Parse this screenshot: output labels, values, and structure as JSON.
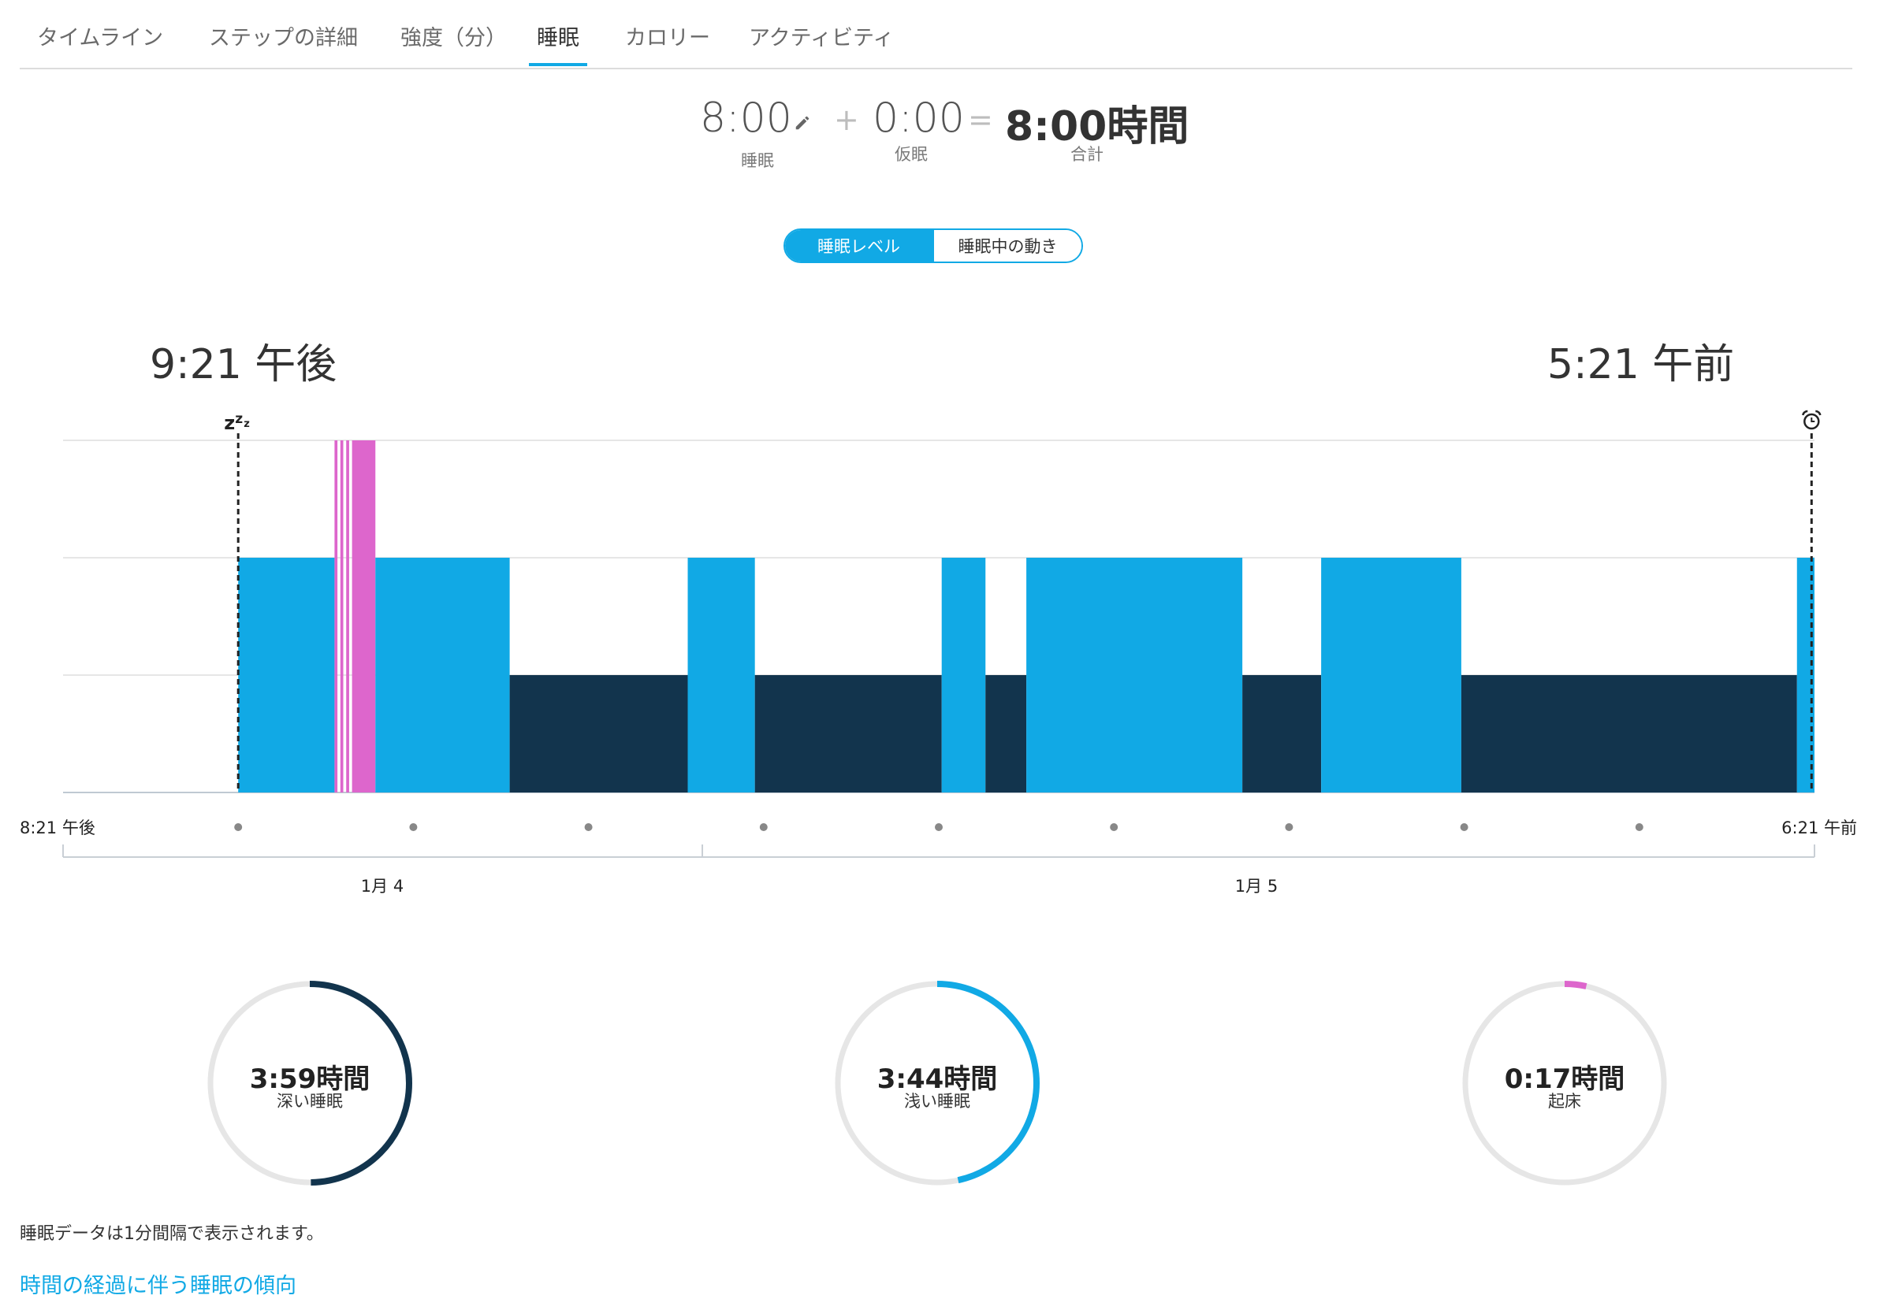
{
  "tabs": [
    {
      "label": "タイムライン"
    },
    {
      "label": "ステップの詳細"
    },
    {
      "label": "強度（分）"
    },
    {
      "label": "睡眠"
    },
    {
      "label": "カロリー"
    },
    {
      "label": "アクティビティ"
    }
  ],
  "active_tab": "睡眠",
  "totals": {
    "sleep_value": "8:00",
    "sleep_label": "睡眠",
    "plus": "+",
    "nap_value": "0:00",
    "nap_label": "仮眠",
    "equals": "=",
    "total_value": "8:00時間",
    "total_label": "合計"
  },
  "toggle": {
    "levels": "睡眠レベル",
    "movement": "睡眠中の動き"
  },
  "sleep_start_time": "9:21 午後",
  "wake_time": "5:21 午前",
  "colors": {
    "deep": "#12344d",
    "light": "#11a9e5",
    "awake": "#dd66cc",
    "grid": "#e6e6e6",
    "track": "#e6e6e6"
  },
  "chart_data": {
    "type": "bar",
    "x_start": "8:21 午後",
    "x_end": "6:21 午前",
    "date_labels": [
      "1月 4",
      "1月 5"
    ],
    "levels": [
      "deep",
      "light",
      "awake"
    ],
    "segments": [
      {
        "level": "light",
        "start": "21:21",
        "end": "21:54"
      },
      {
        "level": "awake",
        "start": "21:54",
        "end": "21:55"
      },
      {
        "level": "awake",
        "start": "21:56",
        "end": "21:57"
      },
      {
        "level": "awake",
        "start": "21:58",
        "end": "21:59"
      },
      {
        "level": "awake",
        "start": "22:00",
        "end": "22:08"
      },
      {
        "level": "light",
        "start": "22:08",
        "end": "22:54"
      },
      {
        "level": "deep",
        "start": "22:54",
        "end": "23:55"
      },
      {
        "level": "light",
        "start": "23:55",
        "end": "00:18"
      },
      {
        "level": "deep",
        "start": "00:18",
        "end": "01:22"
      },
      {
        "level": "light",
        "start": "01:22",
        "end": "01:37"
      },
      {
        "level": "deep",
        "start": "01:37",
        "end": "01:51"
      },
      {
        "level": "light",
        "start": "01:51",
        "end": "03:05"
      },
      {
        "level": "deep",
        "start": "03:05",
        "end": "03:32"
      },
      {
        "level": "light",
        "start": "03:32",
        "end": "04:20"
      },
      {
        "level": "deep",
        "start": "04:20",
        "end": "06:15"
      },
      {
        "level": "light",
        "start": "06:15",
        "end": "06:21"
      }
    ]
  },
  "summary": [
    {
      "value": "3:59時間",
      "label": "深い睡眠",
      "fraction": 0.498,
      "color": "#12344d"
    },
    {
      "value": "3:44時間",
      "label": "浅い睡眠",
      "fraction": 0.466,
      "color": "#11a9e5"
    },
    {
      "value": "0:17時間",
      "label": "起床",
      "fraction": 0.035,
      "color": "#dd66cc"
    }
  ],
  "note": "睡眠データは1分間隔で表示されます。",
  "trend_link": "時間の経過に伴う睡眠の傾向"
}
